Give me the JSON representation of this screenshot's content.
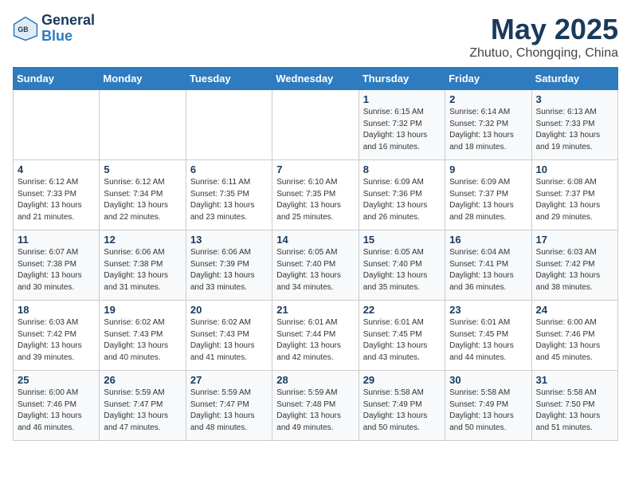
{
  "header": {
    "logo_line1": "General",
    "logo_line2": "Blue",
    "title": "May 2025",
    "subtitle": "Zhutuo, Chongqing, China"
  },
  "days_of_week": [
    "Sunday",
    "Monday",
    "Tuesday",
    "Wednesday",
    "Thursday",
    "Friday",
    "Saturday"
  ],
  "weeks": [
    [
      {
        "day": "",
        "info": ""
      },
      {
        "day": "",
        "info": ""
      },
      {
        "day": "",
        "info": ""
      },
      {
        "day": "",
        "info": ""
      },
      {
        "day": "1",
        "info": "Sunrise: 6:15 AM\nSunset: 7:32 PM\nDaylight: 13 hours\nand 16 minutes."
      },
      {
        "day": "2",
        "info": "Sunrise: 6:14 AM\nSunset: 7:32 PM\nDaylight: 13 hours\nand 18 minutes."
      },
      {
        "day": "3",
        "info": "Sunrise: 6:13 AM\nSunset: 7:33 PM\nDaylight: 13 hours\nand 19 minutes."
      }
    ],
    [
      {
        "day": "4",
        "info": "Sunrise: 6:12 AM\nSunset: 7:33 PM\nDaylight: 13 hours\nand 21 minutes."
      },
      {
        "day": "5",
        "info": "Sunrise: 6:12 AM\nSunset: 7:34 PM\nDaylight: 13 hours\nand 22 minutes."
      },
      {
        "day": "6",
        "info": "Sunrise: 6:11 AM\nSunset: 7:35 PM\nDaylight: 13 hours\nand 23 minutes."
      },
      {
        "day": "7",
        "info": "Sunrise: 6:10 AM\nSunset: 7:35 PM\nDaylight: 13 hours\nand 25 minutes."
      },
      {
        "day": "8",
        "info": "Sunrise: 6:09 AM\nSunset: 7:36 PM\nDaylight: 13 hours\nand 26 minutes."
      },
      {
        "day": "9",
        "info": "Sunrise: 6:09 AM\nSunset: 7:37 PM\nDaylight: 13 hours\nand 28 minutes."
      },
      {
        "day": "10",
        "info": "Sunrise: 6:08 AM\nSunset: 7:37 PM\nDaylight: 13 hours\nand 29 minutes."
      }
    ],
    [
      {
        "day": "11",
        "info": "Sunrise: 6:07 AM\nSunset: 7:38 PM\nDaylight: 13 hours\nand 30 minutes."
      },
      {
        "day": "12",
        "info": "Sunrise: 6:06 AM\nSunset: 7:38 PM\nDaylight: 13 hours\nand 31 minutes."
      },
      {
        "day": "13",
        "info": "Sunrise: 6:06 AM\nSunset: 7:39 PM\nDaylight: 13 hours\nand 33 minutes."
      },
      {
        "day": "14",
        "info": "Sunrise: 6:05 AM\nSunset: 7:40 PM\nDaylight: 13 hours\nand 34 minutes."
      },
      {
        "day": "15",
        "info": "Sunrise: 6:05 AM\nSunset: 7:40 PM\nDaylight: 13 hours\nand 35 minutes."
      },
      {
        "day": "16",
        "info": "Sunrise: 6:04 AM\nSunset: 7:41 PM\nDaylight: 13 hours\nand 36 minutes."
      },
      {
        "day": "17",
        "info": "Sunrise: 6:03 AM\nSunset: 7:42 PM\nDaylight: 13 hours\nand 38 minutes."
      }
    ],
    [
      {
        "day": "18",
        "info": "Sunrise: 6:03 AM\nSunset: 7:42 PM\nDaylight: 13 hours\nand 39 minutes."
      },
      {
        "day": "19",
        "info": "Sunrise: 6:02 AM\nSunset: 7:43 PM\nDaylight: 13 hours\nand 40 minutes."
      },
      {
        "day": "20",
        "info": "Sunrise: 6:02 AM\nSunset: 7:43 PM\nDaylight: 13 hours\nand 41 minutes."
      },
      {
        "day": "21",
        "info": "Sunrise: 6:01 AM\nSunset: 7:44 PM\nDaylight: 13 hours\nand 42 minutes."
      },
      {
        "day": "22",
        "info": "Sunrise: 6:01 AM\nSunset: 7:45 PM\nDaylight: 13 hours\nand 43 minutes."
      },
      {
        "day": "23",
        "info": "Sunrise: 6:01 AM\nSunset: 7:45 PM\nDaylight: 13 hours\nand 44 minutes."
      },
      {
        "day": "24",
        "info": "Sunrise: 6:00 AM\nSunset: 7:46 PM\nDaylight: 13 hours\nand 45 minutes."
      }
    ],
    [
      {
        "day": "25",
        "info": "Sunrise: 6:00 AM\nSunset: 7:46 PM\nDaylight: 13 hours\nand 46 minutes."
      },
      {
        "day": "26",
        "info": "Sunrise: 5:59 AM\nSunset: 7:47 PM\nDaylight: 13 hours\nand 47 minutes."
      },
      {
        "day": "27",
        "info": "Sunrise: 5:59 AM\nSunset: 7:47 PM\nDaylight: 13 hours\nand 48 minutes."
      },
      {
        "day": "28",
        "info": "Sunrise: 5:59 AM\nSunset: 7:48 PM\nDaylight: 13 hours\nand 49 minutes."
      },
      {
        "day": "29",
        "info": "Sunrise: 5:58 AM\nSunset: 7:49 PM\nDaylight: 13 hours\nand 50 minutes."
      },
      {
        "day": "30",
        "info": "Sunrise: 5:58 AM\nSunset: 7:49 PM\nDaylight: 13 hours\nand 50 minutes."
      },
      {
        "day": "31",
        "info": "Sunrise: 5:58 AM\nSunset: 7:50 PM\nDaylight: 13 hours\nand 51 minutes."
      }
    ]
  ]
}
